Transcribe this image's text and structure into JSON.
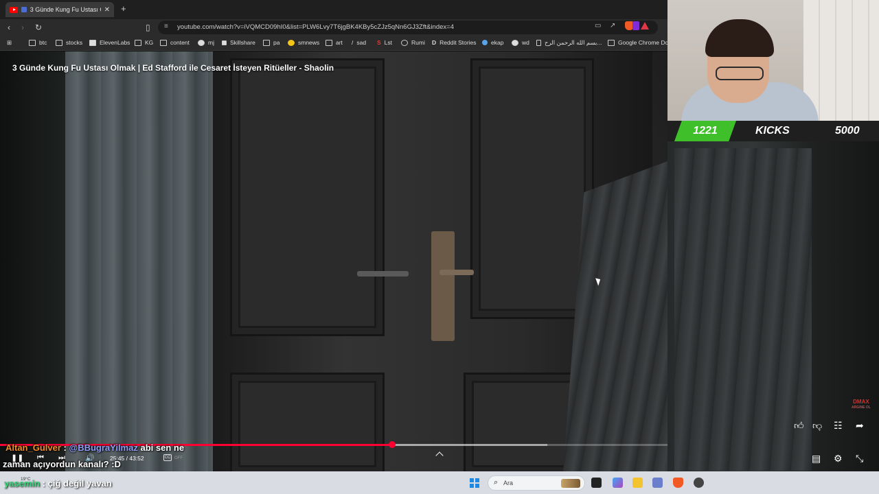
{
  "browser": {
    "tab_title": "3 Günde Kung Fu Ustası Olma",
    "close_tab": "✕",
    "new_tab": "+",
    "url": "youtube.com/watch?v=iVQMCD09hI0&list=PLW6Lvy7T6jgBK4KBy5cZJz5qNn6GJ3Zft&index=4",
    "ext_badge": "25"
  },
  "bookmarks": [
    {
      "label": "btc",
      "icon": "folder"
    },
    {
      "label": "stocks",
      "icon": "folder"
    },
    {
      "label": "ElevenLabs",
      "icon": "elevenlabs"
    },
    {
      "label": "KG",
      "icon": "folder"
    },
    {
      "label": "content",
      "icon": "folder"
    },
    {
      "label": "mj",
      "icon": "github"
    },
    {
      "label": "Skillshare",
      "icon": "skillshare"
    },
    {
      "label": "pa",
      "icon": "folder"
    },
    {
      "label": "smnews",
      "icon": "smnews"
    },
    {
      "label": "art",
      "icon": "folder"
    },
    {
      "label": "sad",
      "icon": "sad"
    },
    {
      "label": "Lst",
      "icon": "lst"
    },
    {
      "label": "Rumi",
      "icon": "rumi"
    },
    {
      "label": "Reddit Stories",
      "icon": "reddit"
    },
    {
      "label": "ekap",
      "icon": "ekap"
    },
    {
      "label": "wd",
      "icon": "wd"
    },
    {
      "label": "بسم الله الرحمن الرح...",
      "icon": "page"
    },
    {
      "label": "Google Chrome Do...",
      "icon": "folder"
    }
  ],
  "video": {
    "title": "3 Günde Kung Fu Ustası Olmak | Ed Stafford ile Cesaret İsteyen Ritüeller - Shaolin",
    "current_time": "25:45",
    "duration": "43:52",
    "time_display": "25:45 / 43:52",
    "progress_fraction": 0.587,
    "buffered_fraction": 0.82,
    "cc_label": "CC",
    "cc_state": "OFF",
    "channel_watermark": "DMAX",
    "channel_watermark_sub": "ARGINE OL"
  },
  "overlay": {
    "kick_count": "1221",
    "kick_label": "KICKS",
    "kick_goal": "5000"
  },
  "chat": [
    {
      "user": "Altan_Gulver",
      "separator": ":",
      "mention": "@BBugraYilmaz",
      "text_line1": "abi sen ne",
      "text_line2": "zaman açıyordun kanalı? :D"
    },
    {
      "user": "yasemin",
      "separator": ":",
      "text": "çiğ değil yavan"
    }
  ],
  "taskbar": {
    "weather": "19°C",
    "search_placeholder": "Ara"
  },
  "colors": {
    "progress": "#ff0033",
    "kick_green": "#3fbf2a",
    "chat_user1": "#f28c28",
    "chat_mention": "#8e9cf7",
    "chat_user2": "#38d47a"
  }
}
